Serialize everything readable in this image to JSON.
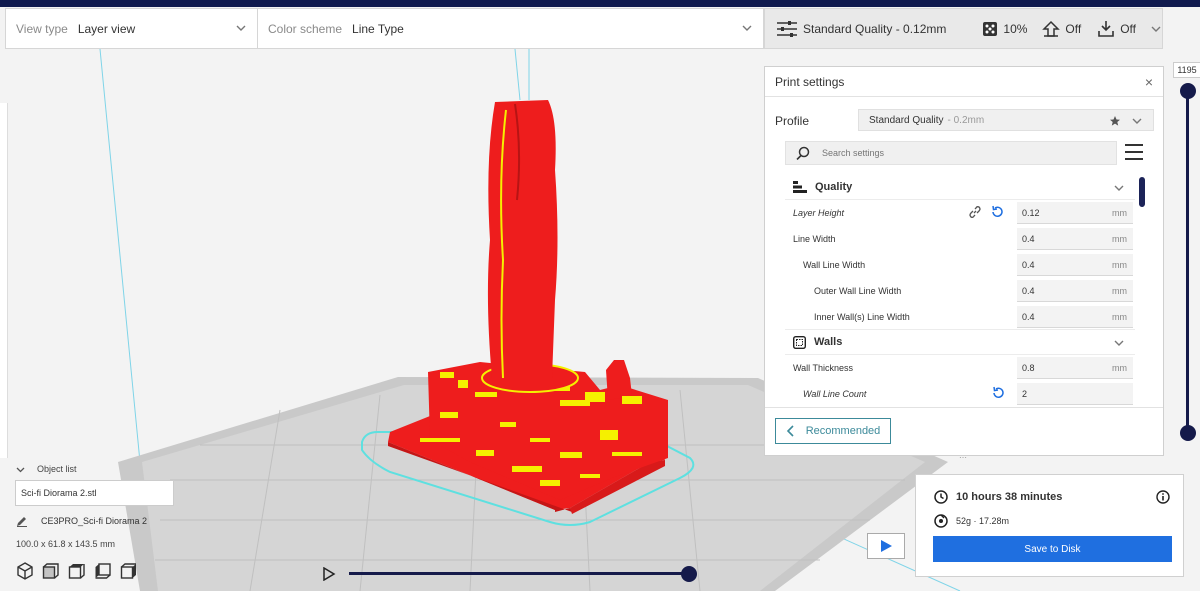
{
  "toolbar": {
    "view_type_label": "View type",
    "view_type_value": "Layer view",
    "color_scheme_label": "Color scheme",
    "color_scheme_value": "Line Type",
    "quality": "Standard Quality - 0.12mm",
    "infill": "10%",
    "support": "Off",
    "adhesion": "Off"
  },
  "panel": {
    "title": "Print settings",
    "close": "×",
    "profile_label": "Profile",
    "profile_value": "Standard Quality",
    "profile_suffix": "- 0.2mm",
    "search_placeholder": "Search settings",
    "sections": {
      "quality": {
        "title": "Quality",
        "rows": [
          {
            "name": "Layer Height",
            "value": "0.12",
            "unit": "mm"
          },
          {
            "name": "Line Width",
            "value": "0.4",
            "unit": "mm"
          },
          {
            "name": "Wall Line Width",
            "value": "0.4",
            "unit": "mm"
          },
          {
            "name": "Outer Wall Line Width",
            "value": "0.4",
            "unit": "mm"
          },
          {
            "name": "Inner Wall(s) Line Width",
            "value": "0.4",
            "unit": "mm"
          }
        ]
      },
      "walls": {
        "title": "Walls",
        "rows": [
          {
            "name": "Wall Thickness",
            "value": "0.8",
            "unit": "mm"
          },
          {
            "name": "Wall Line Count",
            "value": "2",
            "unit": ""
          }
        ]
      }
    },
    "recommended": "Recommended"
  },
  "layer_slider": {
    "current": "1195"
  },
  "estimate": {
    "time": "10 hours 38 minutes",
    "material": "52g · 17.28m",
    "save": "Save to Disk"
  },
  "objects": {
    "list_label": "Object list",
    "file": "Sci-fi Diorama 2.stl",
    "job_name": "CE3PRO_Sci-fi Diorama 2",
    "dimensions": "100.0 x 61.8 x 143.5 mm"
  },
  "colors": {
    "model_red": "#ee1d1d",
    "infill_yellow": "#f5f000",
    "accent_navy": "#151a4a",
    "save_blue": "#1f6fe0",
    "build_outline": "#5ee0e0"
  }
}
